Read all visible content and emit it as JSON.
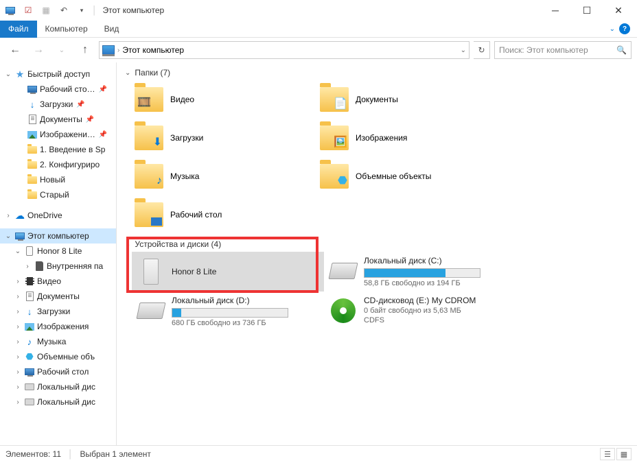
{
  "title": "Этот компьютер",
  "ribbon": {
    "file": "Файл",
    "computer": "Компьютер",
    "view": "Вид"
  },
  "breadcrumb": "Этот компьютер",
  "search_placeholder": "Поиск: Этот компьютер",
  "sidebar": {
    "quick_access": "Быстрый доступ",
    "qa": {
      "desktop": "Рабочий сто…",
      "downloads": "Загрузки",
      "documents": "Документы",
      "pictures": "Изображени…",
      "intro_sp": "1. Введение в Sp",
      "config": "2. Конфигуриро",
      "new": "Новый",
      "old": "Старый"
    },
    "onedrive": "OneDrive",
    "this_pc": "Этот компьютер",
    "honor": "Honor 8 Lite",
    "internal": "Внутренняя па",
    "videos": "Видео",
    "documents2": "Документы",
    "downloads2": "Загрузки",
    "pictures2": "Изображения",
    "music": "Музыка",
    "objects3d": "Объемные объ",
    "desktop2": "Рабочий стол",
    "local_c": "Локальный дис",
    "local_d": "Локальный дис"
  },
  "groups": {
    "folders": "Папки (7)",
    "devices": "Устройства и диски (4)"
  },
  "folders": {
    "videos": "Видео",
    "documents": "Документы",
    "downloads": "Загрузки",
    "pictures": "Изображения",
    "music": "Музыка",
    "objects3d": "Объемные объекты",
    "desktop": "Рабочий стол"
  },
  "devices": {
    "honor": "Honor 8 Lite",
    "disk_c_title": "Локальный диск (C:)",
    "disk_c_sub": "58,8 ГБ свободно из 194 ГБ",
    "disk_d_title": "Локальный диск (D:)",
    "disk_d_sub": "680 ГБ свободно из 736 ГБ",
    "cd_title": "CD-дисковод (E:) My CDROM",
    "cd_sub1": "0 байт свободно из 5,63 МБ",
    "cd_sub2": "CDFS"
  },
  "status": {
    "items": "Элементов: 11",
    "selection": "Выбран 1 элемент"
  }
}
